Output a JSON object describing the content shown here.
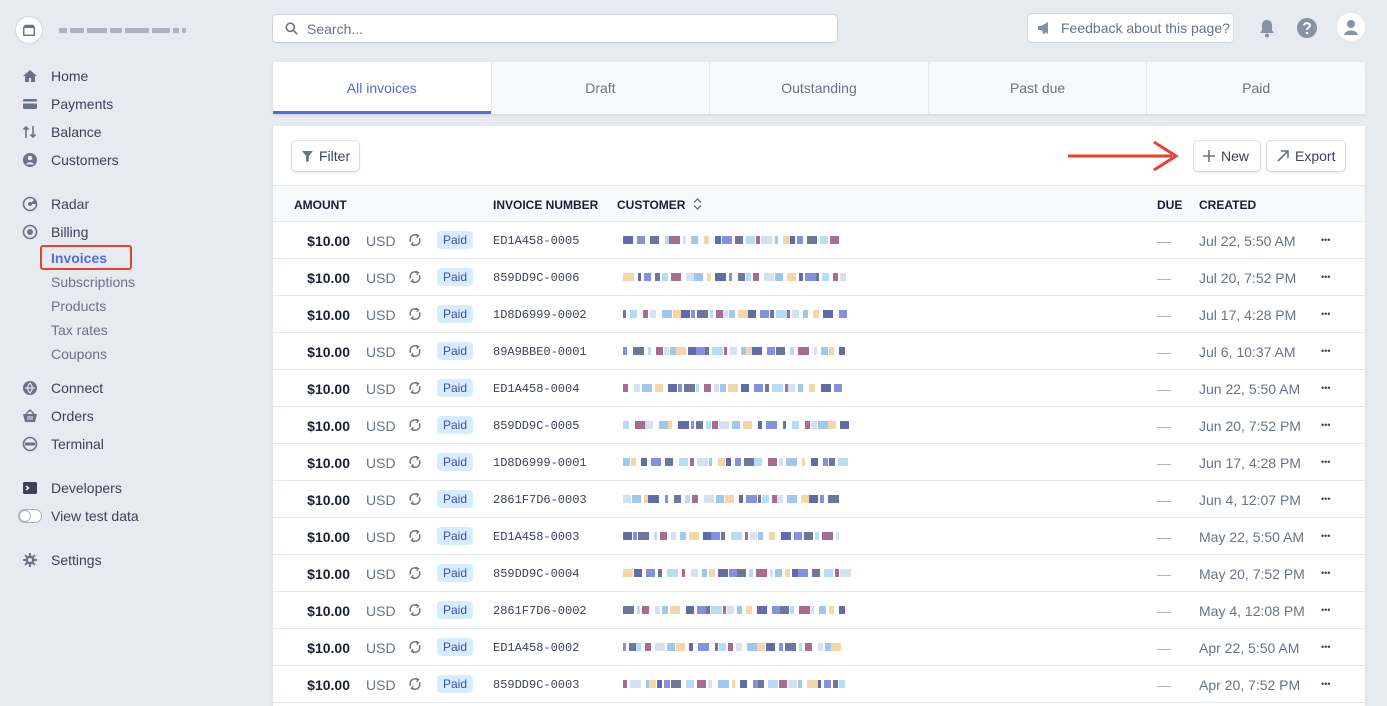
{
  "search": {
    "placeholder": "Search..."
  },
  "header": {
    "feedback_label": "Feedback about this page?"
  },
  "sidebar": {
    "items": [
      {
        "label": "Home",
        "icon": "home-icon"
      },
      {
        "label": "Payments",
        "icon": "payments-icon"
      },
      {
        "label": "Balance",
        "icon": "balance-icon"
      },
      {
        "label": "Customers",
        "icon": "customers-icon"
      },
      {
        "label": "Radar",
        "icon": "radar-icon"
      },
      {
        "label": "Billing",
        "icon": "billing-icon"
      },
      {
        "label": "Connect",
        "icon": "connect-icon"
      },
      {
        "label": "Orders",
        "icon": "orders-icon"
      },
      {
        "label": "Terminal",
        "icon": "terminal-icon"
      },
      {
        "label": "Developers",
        "icon": "developers-icon"
      },
      {
        "label": "View test data",
        "icon": "toggle-icon"
      },
      {
        "label": "Settings",
        "icon": "gear-icon"
      }
    ],
    "billing_sub": [
      "Invoices",
      "Subscriptions",
      "Products",
      "Tax rates",
      "Coupons"
    ]
  },
  "tabs": [
    "All invoices",
    "Draft",
    "Outstanding",
    "Past due",
    "Paid"
  ],
  "toolbar": {
    "filter_label": "Filter",
    "new_label": "New",
    "export_label": "Export"
  },
  "table": {
    "headers": {
      "amount": "AMOUNT",
      "invoice_number": "INVOICE NUMBER",
      "customer": "CUSTOMER",
      "due": "DUE",
      "created": "CREATED"
    },
    "rows": [
      {
        "amount": "$10.00",
        "currency": "USD",
        "status": "Paid",
        "invoice": "ED1A458-0005",
        "due": "—",
        "created": "Jul 22, 5:50 AM"
      },
      {
        "amount": "$10.00",
        "currency": "USD",
        "status": "Paid",
        "invoice": "859DD9C-0006",
        "due": "—",
        "created": "Jul 20, 7:52 PM"
      },
      {
        "amount": "$10.00",
        "currency": "USD",
        "status": "Paid",
        "invoice": "1D8D6999-0002",
        "due": "—",
        "created": "Jul 17, 4:28 PM"
      },
      {
        "amount": "$10.00",
        "currency": "USD",
        "status": "Paid",
        "invoice": "89A9BBE0-0001",
        "due": "—",
        "created": "Jul 6, 10:37 AM"
      },
      {
        "amount": "$10.00",
        "currency": "USD",
        "status": "Paid",
        "invoice": "ED1A458-0004",
        "due": "—",
        "created": "Jun 22, 5:50 AM"
      },
      {
        "amount": "$10.00",
        "currency": "USD",
        "status": "Paid",
        "invoice": "859DD9C-0005",
        "due": "—",
        "created": "Jun 20, 7:52 PM"
      },
      {
        "amount": "$10.00",
        "currency": "USD",
        "status": "Paid",
        "invoice": "1D8D6999-0001",
        "due": "—",
        "created": "Jun 17, 4:28 PM"
      },
      {
        "amount": "$10.00",
        "currency": "USD",
        "status": "Paid",
        "invoice": "2861F7D6-0003",
        "due": "—",
        "created": "Jun 4, 12:07 PM"
      },
      {
        "amount": "$10.00",
        "currency": "USD",
        "status": "Paid",
        "invoice": "ED1A458-0003",
        "due": "—",
        "created": "May 22, 5:50 AM"
      },
      {
        "amount": "$10.00",
        "currency": "USD",
        "status": "Paid",
        "invoice": "859DD9C-0004",
        "due": "—",
        "created": "May 20, 7:52 PM"
      },
      {
        "amount": "$10.00",
        "currency": "USD",
        "status": "Paid",
        "invoice": "2861F7D6-0002",
        "due": "—",
        "created": "May 4, 12:08 PM"
      },
      {
        "amount": "$10.00",
        "currency": "USD",
        "status": "Paid",
        "invoice": "ED1A458-0002",
        "due": "—",
        "created": "Apr 22, 5:50 AM"
      },
      {
        "amount": "$10.00",
        "currency": "USD",
        "status": "Paid",
        "invoice": "859DD9C-0003",
        "due": "—",
        "created": "Apr 20, 7:52 PM"
      }
    ]
  },
  "colors": {
    "accent": "#556cd6",
    "badge_bg": "#d6ecff",
    "annotation_red": "#e5432f",
    "background": "#e6ebf1"
  }
}
